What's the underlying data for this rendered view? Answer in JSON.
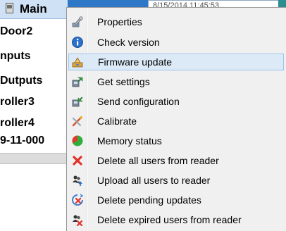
{
  "tree": {
    "header_label": "Main",
    "items": [
      {
        "label": "Door2"
      },
      {
        "label": "nputs"
      },
      {
        "label": "Dutputs"
      },
      {
        "label": "roller3"
      },
      {
        "label": "roller4"
      },
      {
        "label": "9-11-000"
      }
    ]
  },
  "top_field": {
    "text": "8/15/2014 11:45:53"
  },
  "context_menu": {
    "highlighted_index": 2,
    "items": [
      {
        "label": "Properties",
        "icon": "properties-icon"
      },
      {
        "label": "Check version",
        "icon": "info-icon"
      },
      {
        "label": "Firmware update",
        "icon": "firmware-update-icon"
      },
      {
        "label": "Get settings",
        "icon": "get-settings-icon"
      },
      {
        "label": "Send configuration",
        "icon": "send-configuration-icon"
      },
      {
        "label": "Calibrate",
        "icon": "calibrate-icon"
      },
      {
        "label": "Memory status",
        "icon": "memory-status-icon"
      },
      {
        "label": "Delete all users from reader",
        "icon": "delete-users-icon"
      },
      {
        "label": "Upload all users to reader",
        "icon": "upload-users-icon"
      },
      {
        "label": "Delete pending updates",
        "icon": "delete-pending-updates-icon"
      },
      {
        "label": "Delete expired users from reader",
        "icon": "delete-expired-users-icon"
      }
    ]
  },
  "colors": {
    "menu_background": "#f0f0f0",
    "highlight_background": "#dceaf8",
    "highlight_border": "#9cc3ea",
    "tree_header_background": "#cfe1f5"
  }
}
